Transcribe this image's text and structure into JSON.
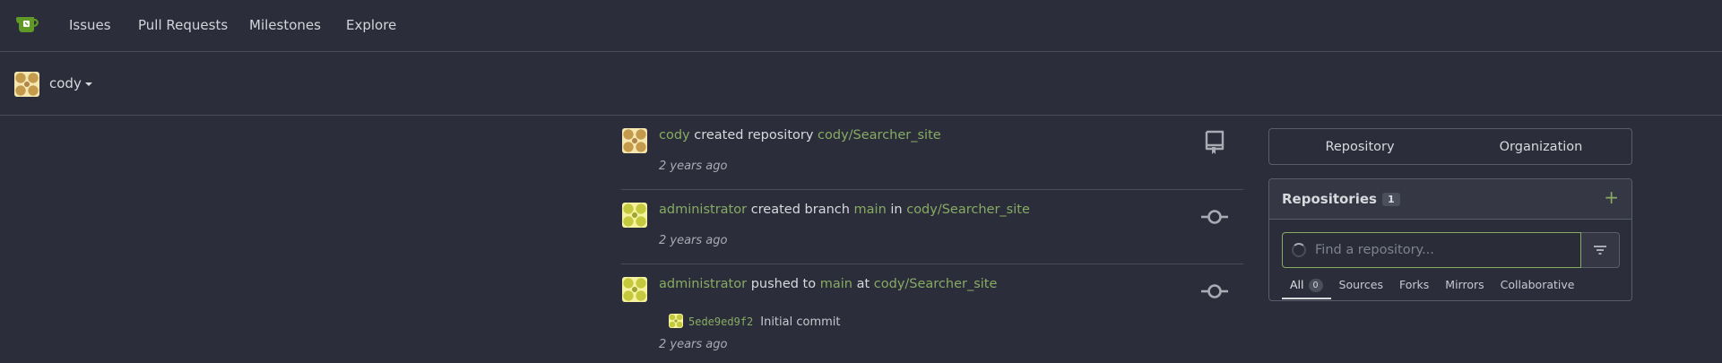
{
  "nav": {
    "logo": "gitea-logo-icon",
    "items": [
      {
        "label": "Issues"
      },
      {
        "label": "Pull Requests"
      },
      {
        "label": "Milestones"
      },
      {
        "label": "Explore"
      }
    ]
  },
  "context": {
    "username": "cody"
  },
  "feed": [
    {
      "actor": "cody",
      "action": "created repository",
      "repo": "cody/Searcher_site",
      "time": "2 years ago",
      "icon": "repo-icon"
    },
    {
      "actor": "administrator",
      "action": "created branch",
      "branch": "main",
      "preposition": "in",
      "repo": "cody/Searcher_site",
      "time": "2 years ago",
      "icon": "git-commit-icon"
    },
    {
      "actor": "administrator",
      "action": "pushed to",
      "branch": "main",
      "preposition": "at",
      "repo": "cody/Searcher_site",
      "commit": {
        "sha": "5ede9ed9f2",
        "message": "Initial commit"
      },
      "time": "2 years ago",
      "icon": "git-commit-icon"
    }
  ],
  "switcher": {
    "repository": "Repository",
    "organization": "Organization"
  },
  "repos": {
    "title": "Repositories",
    "count": "1",
    "search_placeholder": "Find a repository...",
    "tabs": [
      {
        "label": "All",
        "count": "0"
      },
      {
        "label": "Sources"
      },
      {
        "label": "Forks"
      },
      {
        "label": "Mirrors"
      },
      {
        "label": "Collaborative"
      }
    ]
  },
  "colors": {
    "accent": "#87ab63",
    "background": "#2b2d3a",
    "border": "#4a4c58"
  }
}
